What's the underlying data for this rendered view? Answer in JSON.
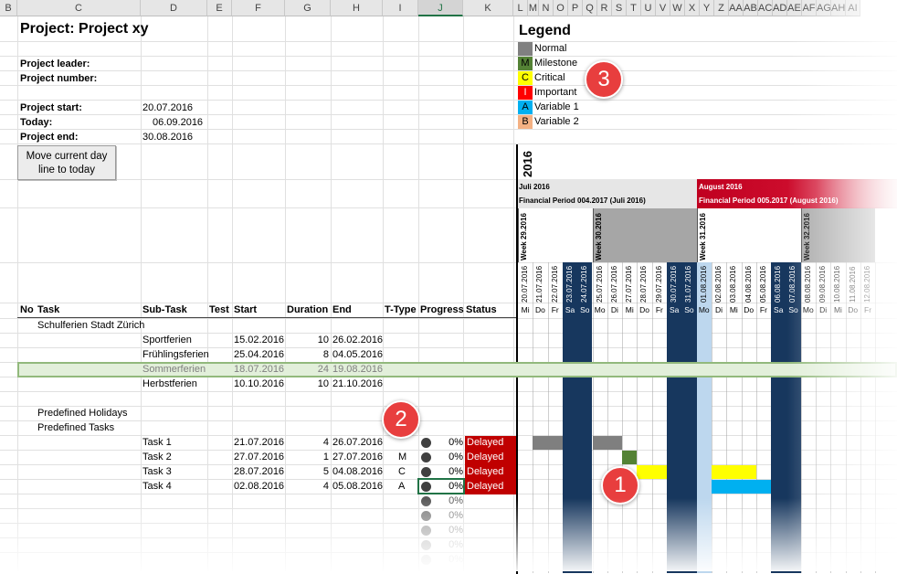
{
  "column_headers": [
    "B",
    "C",
    "D",
    "E",
    "F",
    "G",
    "H",
    "I",
    "J",
    "K",
    "L",
    "M",
    "N",
    "O",
    "P",
    "Q",
    "R",
    "S",
    "T",
    "U",
    "V",
    "W",
    "X",
    "Y",
    "Z",
    "AA",
    "AB",
    "AC",
    "AD",
    "AE",
    "AF",
    "AG",
    "AH",
    "AI"
  ],
  "project": {
    "title": "Project: Project xy",
    "leader_label": "Project leader:",
    "number_label": "Project number:",
    "start_label": "Project start:",
    "start_value": "20.07.2016",
    "today_label": "Today:",
    "today_value": "06.09.2016",
    "end_label": "Project end:",
    "end_value": "30.08.2016"
  },
  "move_button": {
    "line1": "Move current day",
    "line2": "line to today"
  },
  "legend": {
    "title": "Legend",
    "items": [
      {
        "code": "",
        "label": "Normal",
        "color": "#808080"
      },
      {
        "code": "M",
        "label": "Milestone",
        "color": "#548235"
      },
      {
        "code": "C",
        "label": "Critical",
        "color": "#ffff00"
      },
      {
        "code": "I",
        "label": "Important",
        "color": "#ff0000"
      },
      {
        "code": "A",
        "label": "Variable 1",
        "color": "#00b0f0"
      },
      {
        "code": "B",
        "label": "Variable 2",
        "color": "#f4b183"
      }
    ]
  },
  "gantt": {
    "year": "2016",
    "month1": "Juli 2016",
    "period1": "Financial Period 004.2017 (Juli 2016)",
    "month2": "August 2016",
    "period2": "Financial Period 005.2017 (August 2016)",
    "weeks": [
      "Week 29.2016",
      "Week 30.2016",
      "Week 31.2016",
      "Week 32.2016"
    ],
    "dates": [
      "20.07.2016",
      "21.07.2016",
      "22.07.2016",
      "23.07.2016",
      "24.07.2016",
      "25.07.2016",
      "26.07.2016",
      "27.07.2016",
      "28.07.2016",
      "29.07.2016",
      "30.07.2016",
      "31.07.2016",
      "01.08.2016",
      "02.08.2016",
      "03.08.2016",
      "04.08.2016",
      "05.08.2016",
      "06.08.2016",
      "07.08.2016",
      "08.08.2016",
      "09.08.2016",
      "10.08.2016",
      "11.08.2016",
      "12.08.2016"
    ],
    "dows": [
      "Mi",
      "Do",
      "Fr",
      "Sa",
      "So",
      "Mo",
      "Di",
      "Mi",
      "Do",
      "Fr",
      "Sa",
      "So",
      "Mo",
      "Di",
      "Mi",
      "Do",
      "Fr",
      "Sa",
      "So",
      "Mo",
      "Di",
      "Mi",
      "Do",
      "Fr"
    ]
  },
  "table_headers": {
    "no": "No",
    "task": "Task",
    "subtask": "Sub-Task",
    "test": "Test",
    "start": "Start",
    "duration": "Duration",
    "end": "End",
    "ttype": "T-Type",
    "progress": "Progress",
    "status": "Status"
  },
  "group1": "Schulferien Stadt Zürich",
  "ferien": [
    {
      "name": "Sportferien",
      "start": "15.02.2016",
      "dur": "10",
      "end": "26.02.2016"
    },
    {
      "name": "Frühlingsferien",
      "start": "25.04.2016",
      "dur": "8",
      "end": "04.05.2016"
    },
    {
      "name": "Sommerferien",
      "start": "18.07.2016",
      "dur": "24",
      "end": "19.08.2016"
    },
    {
      "name": "Herbstferien",
      "start": "10.10.2016",
      "dur": "10",
      "end": "21.10.2016"
    }
  ],
  "group2": "Predefined Holidays",
  "group3": "Predefined Tasks",
  "tasks": [
    {
      "name": "Task 1",
      "start": "21.07.2016",
      "dur": "4",
      "end": "26.07.2016",
      "type": "",
      "progress": "0%",
      "status": "Delayed"
    },
    {
      "name": "Task 2",
      "start": "27.07.2016",
      "dur": "1",
      "end": "27.07.2016",
      "type": "M",
      "progress": "0%",
      "status": "Delayed"
    },
    {
      "name": "Task 3",
      "start": "28.07.2016",
      "dur": "5",
      "end": "04.08.2016",
      "type": "C",
      "progress": "0%",
      "status": "Delayed"
    },
    {
      "name": "Task 4",
      "start": "02.08.2016",
      "dur": "4",
      "end": "05.08.2016",
      "type": "A",
      "progress": "0%",
      "status": "Delayed"
    }
  ],
  "empty_progress": [
    "0%",
    "0%",
    "0%",
    "0%",
    "0%"
  ],
  "callouts": [
    "1",
    "2",
    "3"
  ]
}
